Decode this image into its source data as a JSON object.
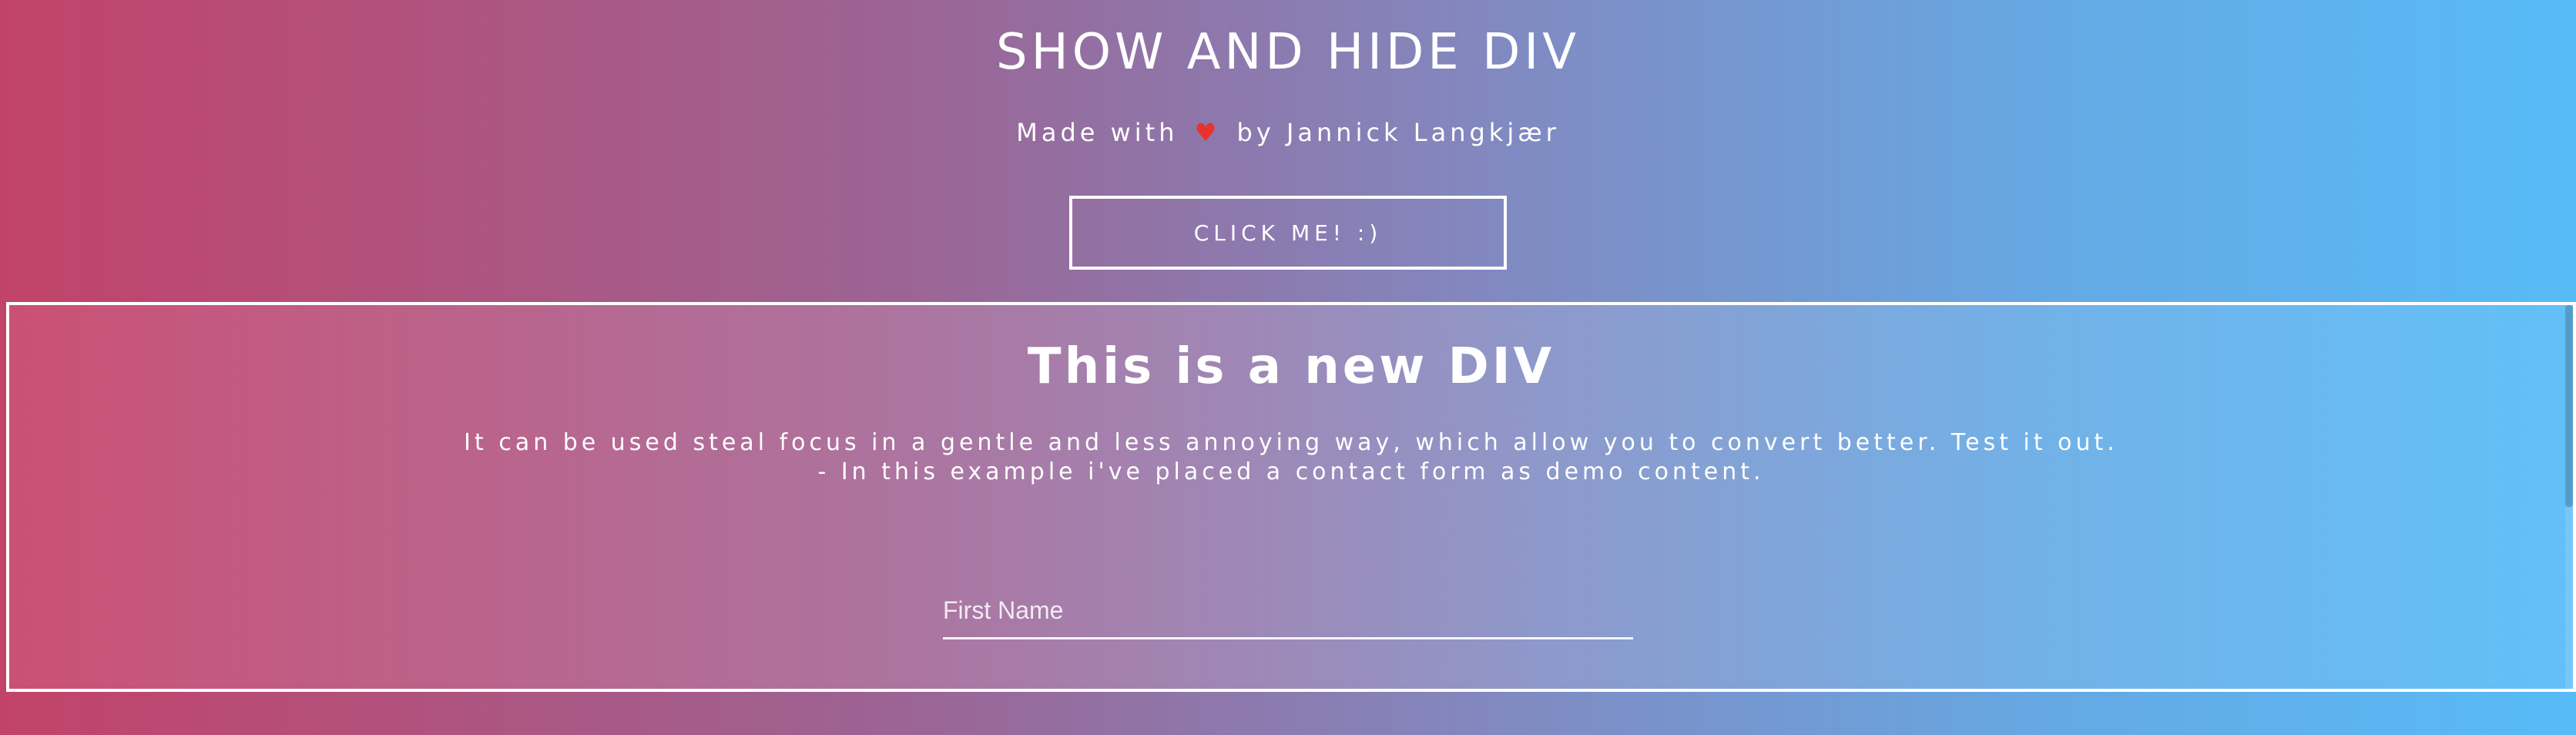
{
  "header": {
    "title": "SHOW AND HIDE DIV",
    "credit_prefix": "Made with",
    "credit_heart": "♥",
    "credit_suffix": "by Jannick Langkjær"
  },
  "toggle_button": {
    "label": "CLICK ME! :)"
  },
  "panel": {
    "title": "This is a new DIV",
    "description_line1": "It can be used steal focus in a gentle and less annoying way, which allow you to convert better. Test it out.",
    "description_line2": "- In this example i've placed a contact form as demo content."
  },
  "form": {
    "first_name_placeholder": "First Name",
    "first_name_value": ""
  },
  "colors": {
    "gradient_start": "#c2436a",
    "gradient_end": "#57bbf7",
    "heart": "#e8322b"
  },
  "icons": {
    "heart": "heart-icon"
  }
}
